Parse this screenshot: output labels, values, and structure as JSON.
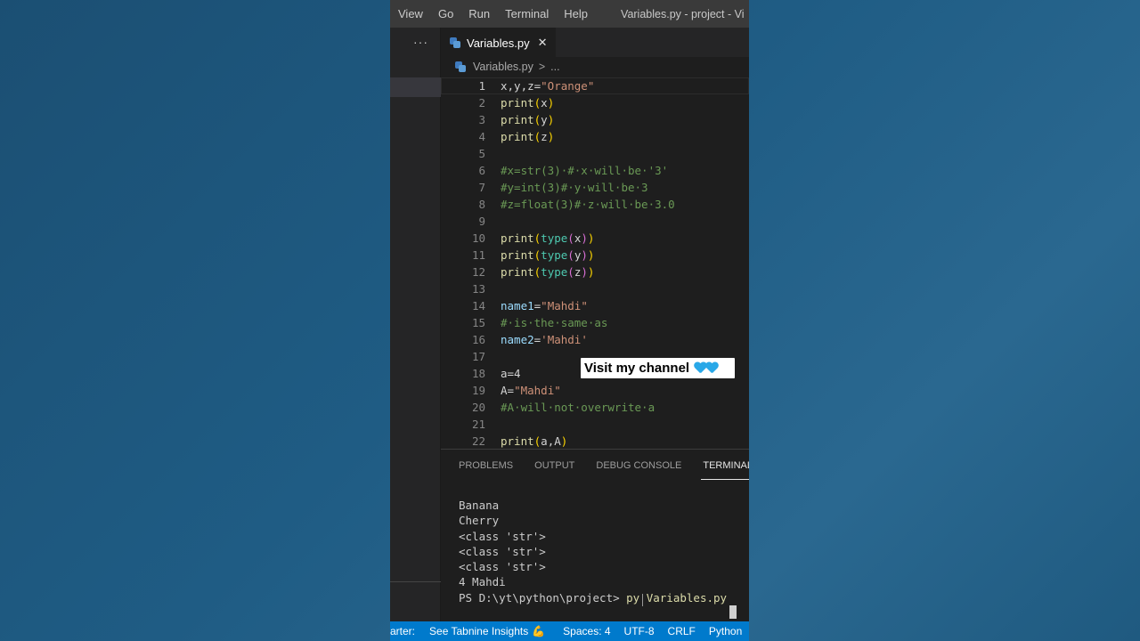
{
  "menubar": {
    "items": [
      "View",
      "Go",
      "Run",
      "Terminal",
      "Help"
    ],
    "window_title": "Variables.py - project - Vi"
  },
  "explorer": {
    "more_label": "···"
  },
  "tab": {
    "label": "Variables.py",
    "close": "✕"
  },
  "breadcrumb": {
    "file": "Variables.py",
    "sep": ">",
    "rest": "..."
  },
  "editor": {
    "line_numbers": [
      "1",
      "2",
      "3",
      "4",
      "5",
      "6",
      "7",
      "8",
      "9",
      "10",
      "11",
      "12",
      "13",
      "14",
      "15",
      "16",
      "17",
      "18",
      "19",
      "20",
      "21",
      "22"
    ],
    "lines": [
      "x,y,z=\"Orange\"",
      "print(x)",
      "print(y)",
      "print(z)",
      "",
      "#x=str(3)·#·x·will·be·'3'",
      "#y=int(3)#·y·will·be·3",
      "#z=float(3)#·z·will·be·3.0",
      "",
      "print(type(x))",
      "print(type(y))",
      "print(type(z))",
      "",
      "name1=\"Mahdi\"",
      "#·is·the·same·as",
      "name2='Mahdi'",
      "",
      "a=4",
      "A=\"Mahdi\"",
      "#A·will·not·overwrite·a",
      "",
      "print(a,A)"
    ]
  },
  "overlay": {
    "text": "Visit my channel"
  },
  "panel": {
    "tabs": [
      "PROBLEMS",
      "OUTPUT",
      "DEBUG CONSOLE",
      "TERMINAL"
    ],
    "active_tab": "TERMINAL",
    "output": [
      "Banana",
      "Cherry",
      "<class 'str'>",
      "<class 'str'>",
      "<class 'str'>",
      "4 Mahdi"
    ],
    "prompt": "PS D:\\yt\\python\\project> ",
    "command": "py Variables.py"
  },
  "statusbar": {
    "left": "arter:",
    "tabnine": "See Tabnine Insights",
    "spaces": "Spaces: 4",
    "encoding": "UTF-8",
    "eol": "CRLF",
    "language": "Python"
  },
  "colors": {
    "statusbar": "#007acc",
    "editor_bg": "#1e1e1e",
    "background": "#1f5c84"
  }
}
